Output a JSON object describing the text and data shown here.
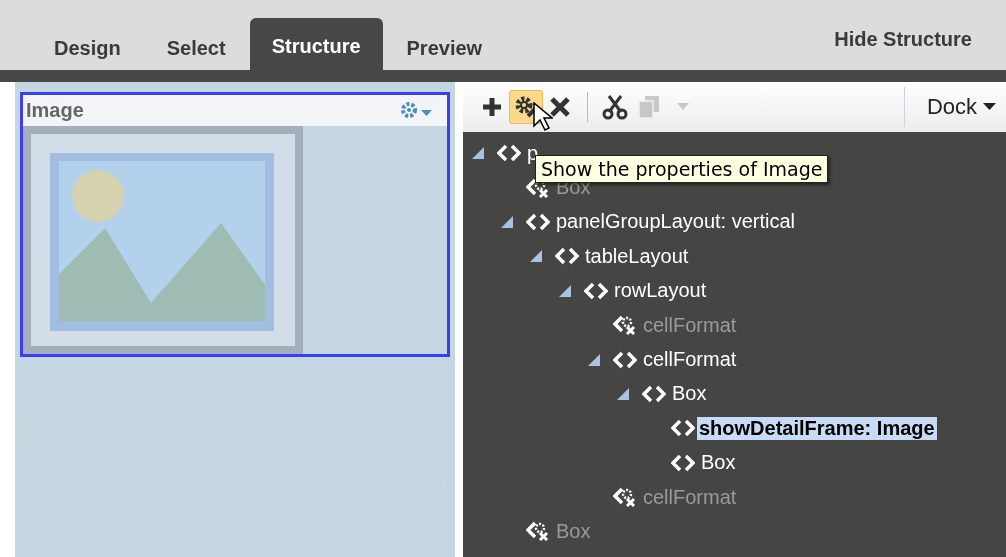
{
  "tabs": [
    {
      "label": "Design",
      "selected": false
    },
    {
      "label": "Select",
      "selected": false
    },
    {
      "label": "Structure",
      "selected": true
    },
    {
      "label": "Preview",
      "selected": false
    }
  ],
  "hide_structure": "Hide Structure",
  "image_component": {
    "title": "Image",
    "selected": true
  },
  "toolbar": {
    "groups": [
      [
        {
          "kind": "add",
          "disabled": false,
          "hovered": false
        },
        {
          "kind": "properties",
          "disabled": false,
          "hovered": true
        },
        {
          "kind": "delete",
          "disabled": false,
          "hovered": false
        }
      ],
      [
        {
          "kind": "cut",
          "disabled": false,
          "hovered": false
        },
        {
          "kind": "copy",
          "disabled": true,
          "hovered": false
        },
        {
          "kind": "menu",
          "disabled": true,
          "hovered": false
        }
      ]
    ],
    "dock": "Dock"
  },
  "tooltip": "Show the properties of Image",
  "tree": [
    {
      "label": "p",
      "expanded": true,
      "hidden": false,
      "selected": false,
      "children": [
        {
          "label": "Box",
          "expanded": false,
          "hidden": true,
          "selected": false
        },
        {
          "label": "panelGroupLayout: vertical",
          "expanded": true,
          "hidden": false,
          "selected": false,
          "children": [
            {
              "label": "tableLayout",
              "expanded": true,
              "hidden": false,
              "selected": false,
              "children": [
                {
                  "label": "rowLayout",
                  "expanded": true,
                  "hidden": false,
                  "selected": false,
                  "children": [
                    {
                      "label": "cellFormat",
                      "expanded": false,
                      "hidden": true,
                      "selected": false
                    },
                    {
                      "label": "cellFormat",
                      "expanded": true,
                      "hidden": false,
                      "selected": false,
                      "children": [
                        {
                          "label": "Box",
                          "expanded": true,
                          "hidden": false,
                          "selected": false,
                          "children": [
                            {
                              "label": "showDetailFrame: Image",
                              "expanded": false,
                              "hidden": false,
                              "selected": true
                            },
                            {
                              "label": "Box",
                              "expanded": false,
                              "hidden": false,
                              "selected": false
                            }
                          ]
                        }
                      ]
                    },
                    {
                      "label": "cellFormat",
                      "expanded": false,
                      "hidden": true,
                      "selected": false
                    }
                  ]
                }
              ]
            }
          ]
        },
        {
          "label": "Box",
          "expanded": false,
          "hidden": true,
          "selected": false
        }
      ]
    }
  ]
}
